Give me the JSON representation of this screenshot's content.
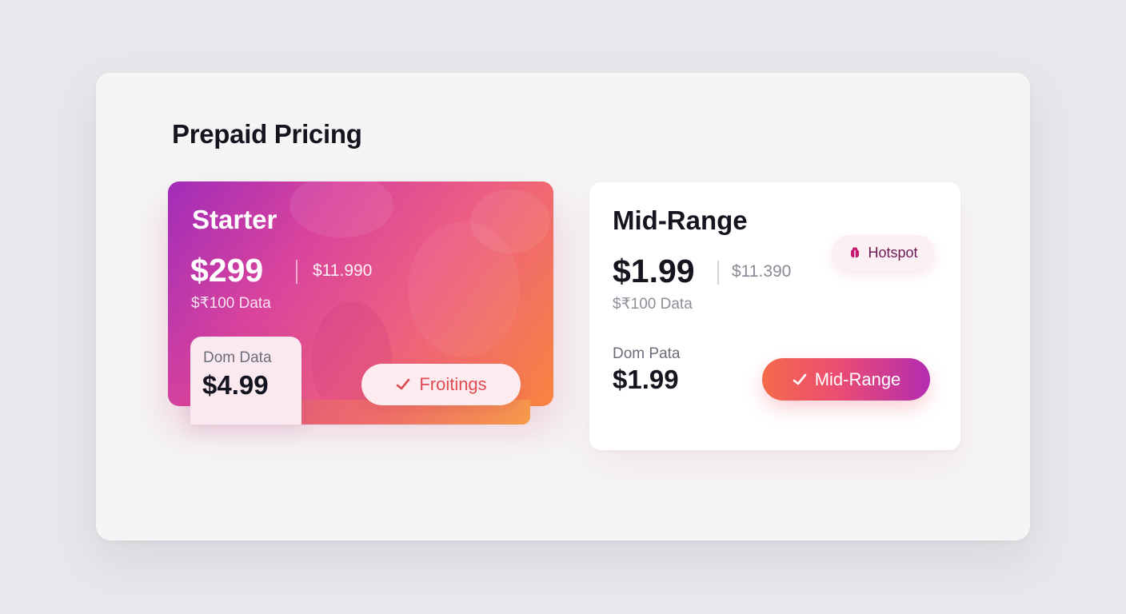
{
  "page": {
    "title": "Prepaid Pricing"
  },
  "plans": {
    "starter": {
      "name": "Starter",
      "price": "$299",
      "alt_price": "$11.990",
      "data_label": "$₹100 Data",
      "dom_label": "Dom Data",
      "dom_price": "$4.99",
      "button_label": "Froitings",
      "button_icon": "check-icon",
      "colors": {
        "gradient_start": "#a12cb9",
        "gradient_end": "#f9843f",
        "button_text": "#e04a52"
      }
    },
    "mid_range": {
      "name": "Mid-Range",
      "price": "$1.99",
      "alt_price": "$11.390",
      "data_label": "$₹100 Data",
      "dom_label": "Dom Pata",
      "dom_price": "$1.99",
      "badge_label": "Hotspot",
      "badge_icon": "hotspot-icon",
      "button_label": "Mid-Range",
      "button_icon": "check-icon",
      "colors": {
        "button_start": "#f46a4a",
        "button_end": "#b32cb0",
        "badge_text": "#6a1a54"
      }
    }
  }
}
